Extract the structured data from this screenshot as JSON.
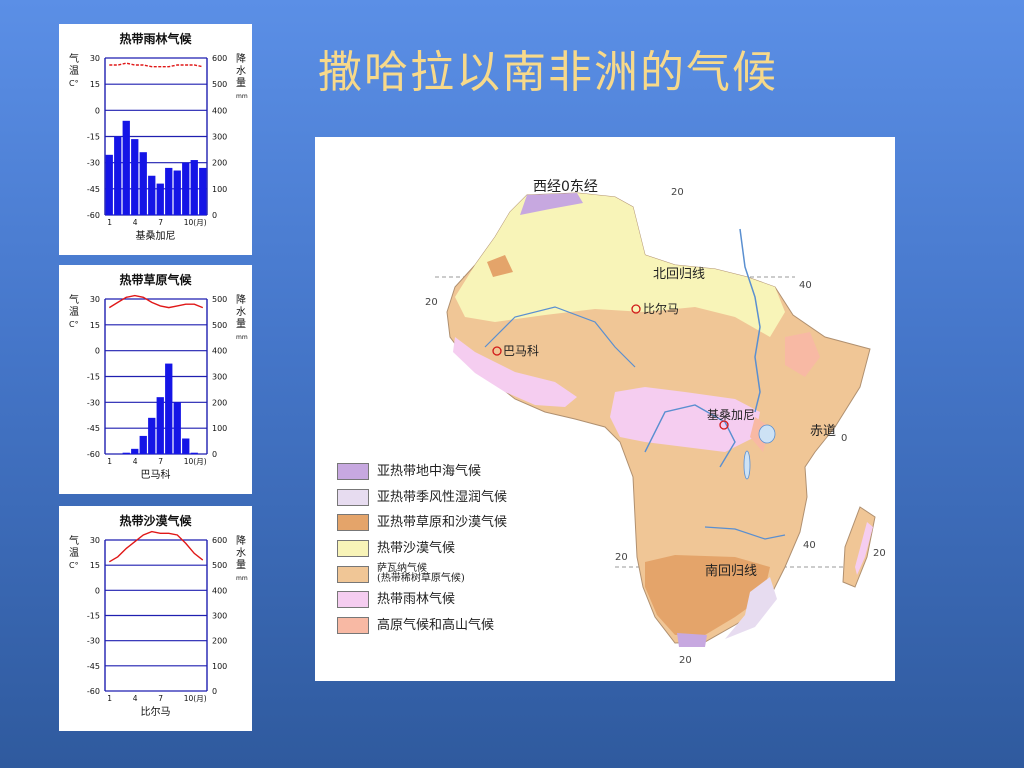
{
  "slide": {
    "title": "撒哈拉以南非洲的气候"
  },
  "climate_charts": [
    {
      "title": "热带雨林气候",
      "station": "基桑加尼",
      "temp_axis_label": [
        "气",
        "温",
        "C°"
      ],
      "precip_axis_label": [
        "降",
        "水",
        "量",
        "mm"
      ],
      "temp_ticks": [
        "30",
        "15",
        "0",
        "-15",
        "-30",
        "-45",
        "-60"
      ],
      "precip_ticks": [
        "600",
        "500",
        "400",
        "300",
        "200",
        "100",
        "0"
      ],
      "month_ticks": [
        "1",
        "4",
        "7",
        "10(月)"
      ],
      "precip_mm": [
        230,
        300,
        360,
        290,
        240,
        150,
        120,
        180,
        170,
        200,
        210,
        180
      ],
      "temp_c": [
        26,
        26,
        27,
        26,
        26,
        25,
        25,
        25,
        26,
        26,
        26,
        25
      ]
    },
    {
      "title": "热带草原气候",
      "station": "巴马科",
      "temp_axis_label": [
        "气",
        "温",
        "C°"
      ],
      "precip_axis_label": [
        "降",
        "水",
        "量",
        "mm"
      ],
      "temp_ticks": [
        "30",
        "15",
        "0",
        "-15",
        "-30",
        "-45",
        "-60"
      ],
      "precip_ticks": [
        "500",
        "500",
        "400",
        "300",
        "200",
        "100",
        "0"
      ],
      "month_ticks": [
        "1",
        "4",
        "7",
        "10(月)"
      ],
      "precip_mm": [
        0,
        0,
        5,
        20,
        70,
        140,
        220,
        350,
        200,
        60,
        5,
        0
      ],
      "temp_c": [
        25,
        28,
        31,
        32,
        31,
        28,
        26,
        25,
        26,
        27,
        27,
        25
      ]
    },
    {
      "title": "热带沙漠气候",
      "station": "比尔马",
      "temp_axis_label": [
        "气",
        "温",
        "C°"
      ],
      "precip_axis_label": [
        "降",
        "水",
        "量",
        "mm"
      ],
      "temp_ticks": [
        "30",
        "15",
        "0",
        "-15",
        "-30",
        "-45",
        "-60"
      ],
      "precip_ticks": [
        "600",
        "500",
        "400",
        "300",
        "200",
        "100",
        "0"
      ],
      "month_ticks": [
        "1",
        "4",
        "7",
        "10(月)"
      ],
      "precip_mm": [
        0,
        0,
        0,
        0,
        0,
        0,
        0,
        0,
        0,
        0,
        0,
        0
      ],
      "temp_c": [
        17,
        20,
        25,
        29,
        33,
        35,
        34,
        34,
        33,
        28,
        22,
        18
      ]
    }
  ],
  "map": {
    "labels": {
      "meridian": "西经0东经",
      "tropic_north": "北回归线",
      "tropic_south": "南回归线",
      "equator": "赤道",
      "city_bilma": "比尔马",
      "city_bamako": "巴马科",
      "city_kisangani": "基桑加尼"
    },
    "ticks": {
      "top_20": "20",
      "right_40": "40",
      "left_20": "20",
      "equator_0": "0",
      "south_20": "20",
      "south_40": "40",
      "madagascar_20": "20",
      "bottom_20": "20"
    },
    "legend": [
      {
        "label": "亚热带地中海气候",
        "color": "#c7a8e0"
      },
      {
        "label": "亚热带季风性湿润气候",
        "color": "#e7dcf0"
      },
      {
        "label": "亚热带草原和沙漠气候",
        "color": "#e4a46a"
      },
      {
        "label": "热带沙漠气候",
        "color": "#f8f4b8"
      },
      {
        "label": "萨瓦纳气候",
        "label2": "(热带稀树草原气候)",
        "color": "#f0c696"
      },
      {
        "label": "热带雨林气候",
        "color": "#f5cdf0"
      },
      {
        "label": "高原气候和高山气候",
        "color": "#f8b9a4"
      }
    ]
  },
  "colors": {
    "bar": "#1515e6",
    "temp_line": "#e01818",
    "grid": "#1f1fb0",
    "title": "#f7d98a"
  }
}
